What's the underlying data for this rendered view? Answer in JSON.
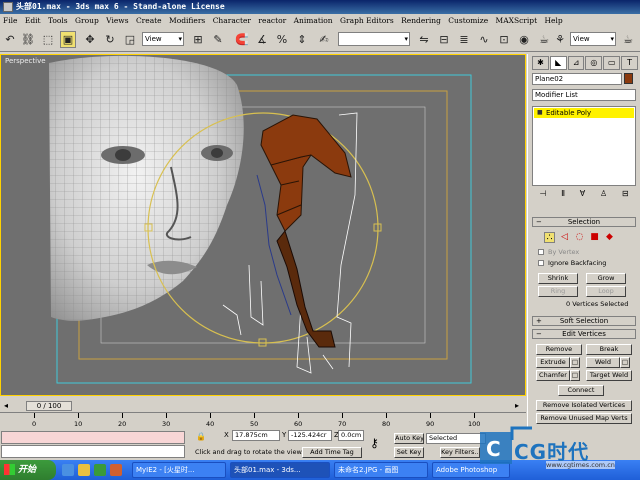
{
  "window": {
    "title": "头部01.max - 3ds max 6 - Stand-alone License"
  },
  "menu": [
    "File",
    "Edit",
    "Tools",
    "Group",
    "Views",
    "Create",
    "Modifiers",
    "Character",
    "reactor",
    "Animation",
    "Graph Editors",
    "Rendering",
    "Customize",
    "MAXScript",
    "Help"
  ],
  "toolbar": {
    "ref_coord": "View",
    "named_sel": "",
    "render_view": "View"
  },
  "viewport": {
    "label": "Perspective"
  },
  "command_panel": {
    "object_name": "Plane02",
    "modifier_list": "Modifier List",
    "stack_item": "Editable Poly",
    "object_color": "#8b3a0e",
    "selection": {
      "title": "Selection",
      "by_vertex": "By Vertex",
      "ignore_backfacing": "Ignore Backfacing",
      "shrink": "Shrink",
      "grow": "Grow",
      "ring": "Ring",
      "loop": "Loop",
      "status": "0 Vertices Selected"
    },
    "soft_selection": {
      "title": "Soft Selection"
    },
    "edit_vertices": {
      "title": "Edit Vertices",
      "remove": "Remove",
      "break": "Break",
      "extrude": "Extrude",
      "weld": "Weld",
      "chamfer": "Chamfer",
      "target_weld": "Target Weld",
      "connect": "Connect",
      "remove_isolated": "Remove Isolated Vertices",
      "remove_unused": "Remove Unused Map Verts"
    }
  },
  "time": {
    "slider": "0 / 100",
    "ticks": [
      "0",
      "10",
      "20",
      "30",
      "40",
      "50",
      "60",
      "70",
      "80",
      "90",
      "100"
    ]
  },
  "status": {
    "x": "17.875cm",
    "y": "-125.424cr",
    "z": "0.0cm",
    "prompt": "Click and drag to rotate the view.",
    "add_time_tag": "Add Time Tag",
    "auto_key": "Auto Key",
    "set_key": "Set Key",
    "key_mode": "Selected",
    "key_filters": "Key Filters..."
  },
  "taskbar": {
    "start": "开始",
    "tasks": [
      "MyIE2 - [火星时...",
      "头部01.max - 3ds...",
      "未命名2.JPG - 画图",
      "Adobe Photoshop"
    ]
  },
  "watermark": {
    "brand": "CG时代",
    "url": "www.cgtimes.com.cn"
  },
  "colors": {
    "selection_yellow": "#fff200",
    "active_border": "#ffd200",
    "hair_brown": "#8b3a0e"
  }
}
